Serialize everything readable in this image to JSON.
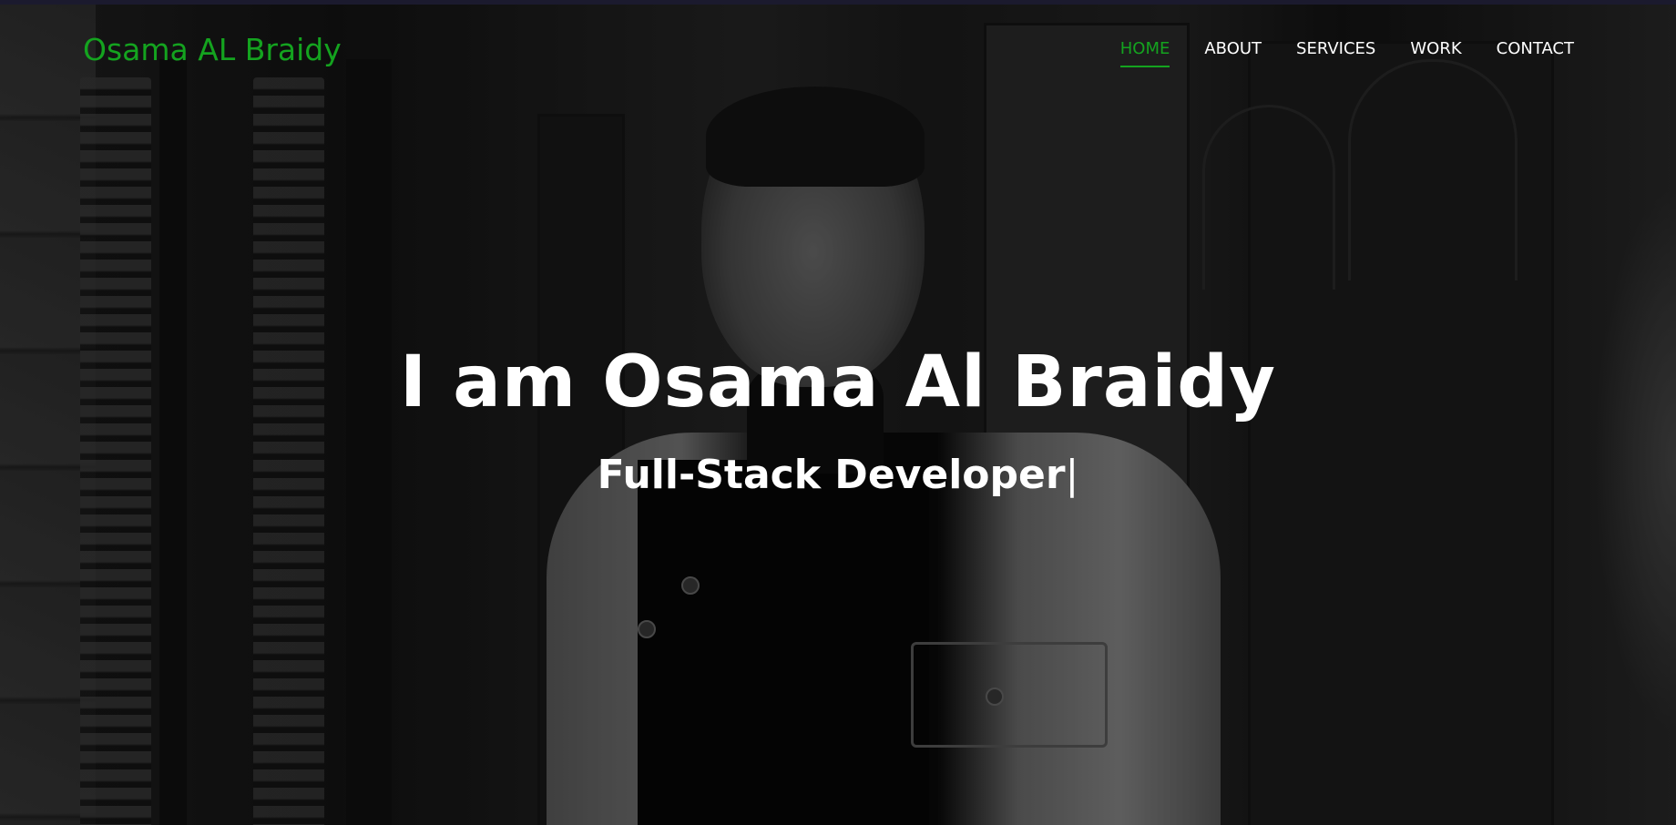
{
  "brand": "Osama AL Braidy",
  "nav": {
    "items": [
      {
        "label": "HOME",
        "active": true
      },
      {
        "label": "ABOUT",
        "active": false
      },
      {
        "label": "SERVICES",
        "active": false
      },
      {
        "label": "WORK",
        "active": false
      },
      {
        "label": "CONTACT",
        "active": false
      }
    ]
  },
  "hero": {
    "title": "I am Osama Al Braidy",
    "subtitle": "Full-Stack Developer",
    "cursor": "|",
    "background_image": "grayscale-portrait-photo"
  },
  "colors": {
    "accent": "#14a31f",
    "text": "#ffffff",
    "top_strip": "#1b1a2e"
  }
}
